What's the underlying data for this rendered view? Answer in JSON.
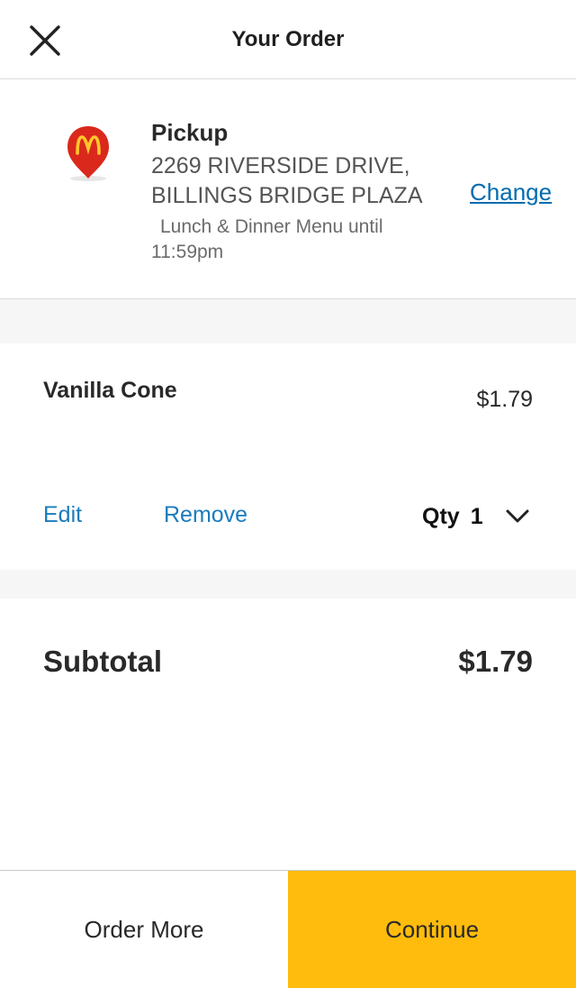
{
  "header": {
    "title": "Your Order",
    "close_icon": "close-icon"
  },
  "pickup": {
    "label": "Pickup",
    "address_line1": "2269 RIVERSIDE DRIVE,",
    "address_line2": "BILLINGS BRIDGE PLAZA",
    "menu_note": "Lunch & Dinner Menu until 11:59pm",
    "change_label": "Change",
    "pin_icon": "mcdonalds-location-pin-icon"
  },
  "items": [
    {
      "name": "Vanilla Cone",
      "price": "$1.79",
      "edit_label": "Edit",
      "remove_label": "Remove",
      "qty_label": "Qty",
      "qty_value": "1"
    }
  ],
  "subtotal": {
    "label": "Subtotal",
    "value": "$1.79"
  },
  "footer": {
    "order_more_label": "Order More",
    "continue_label": "Continue"
  },
  "colors": {
    "accent": "#ffbc0d",
    "link": "#1b7bbd",
    "brand_red": "#da291c"
  }
}
